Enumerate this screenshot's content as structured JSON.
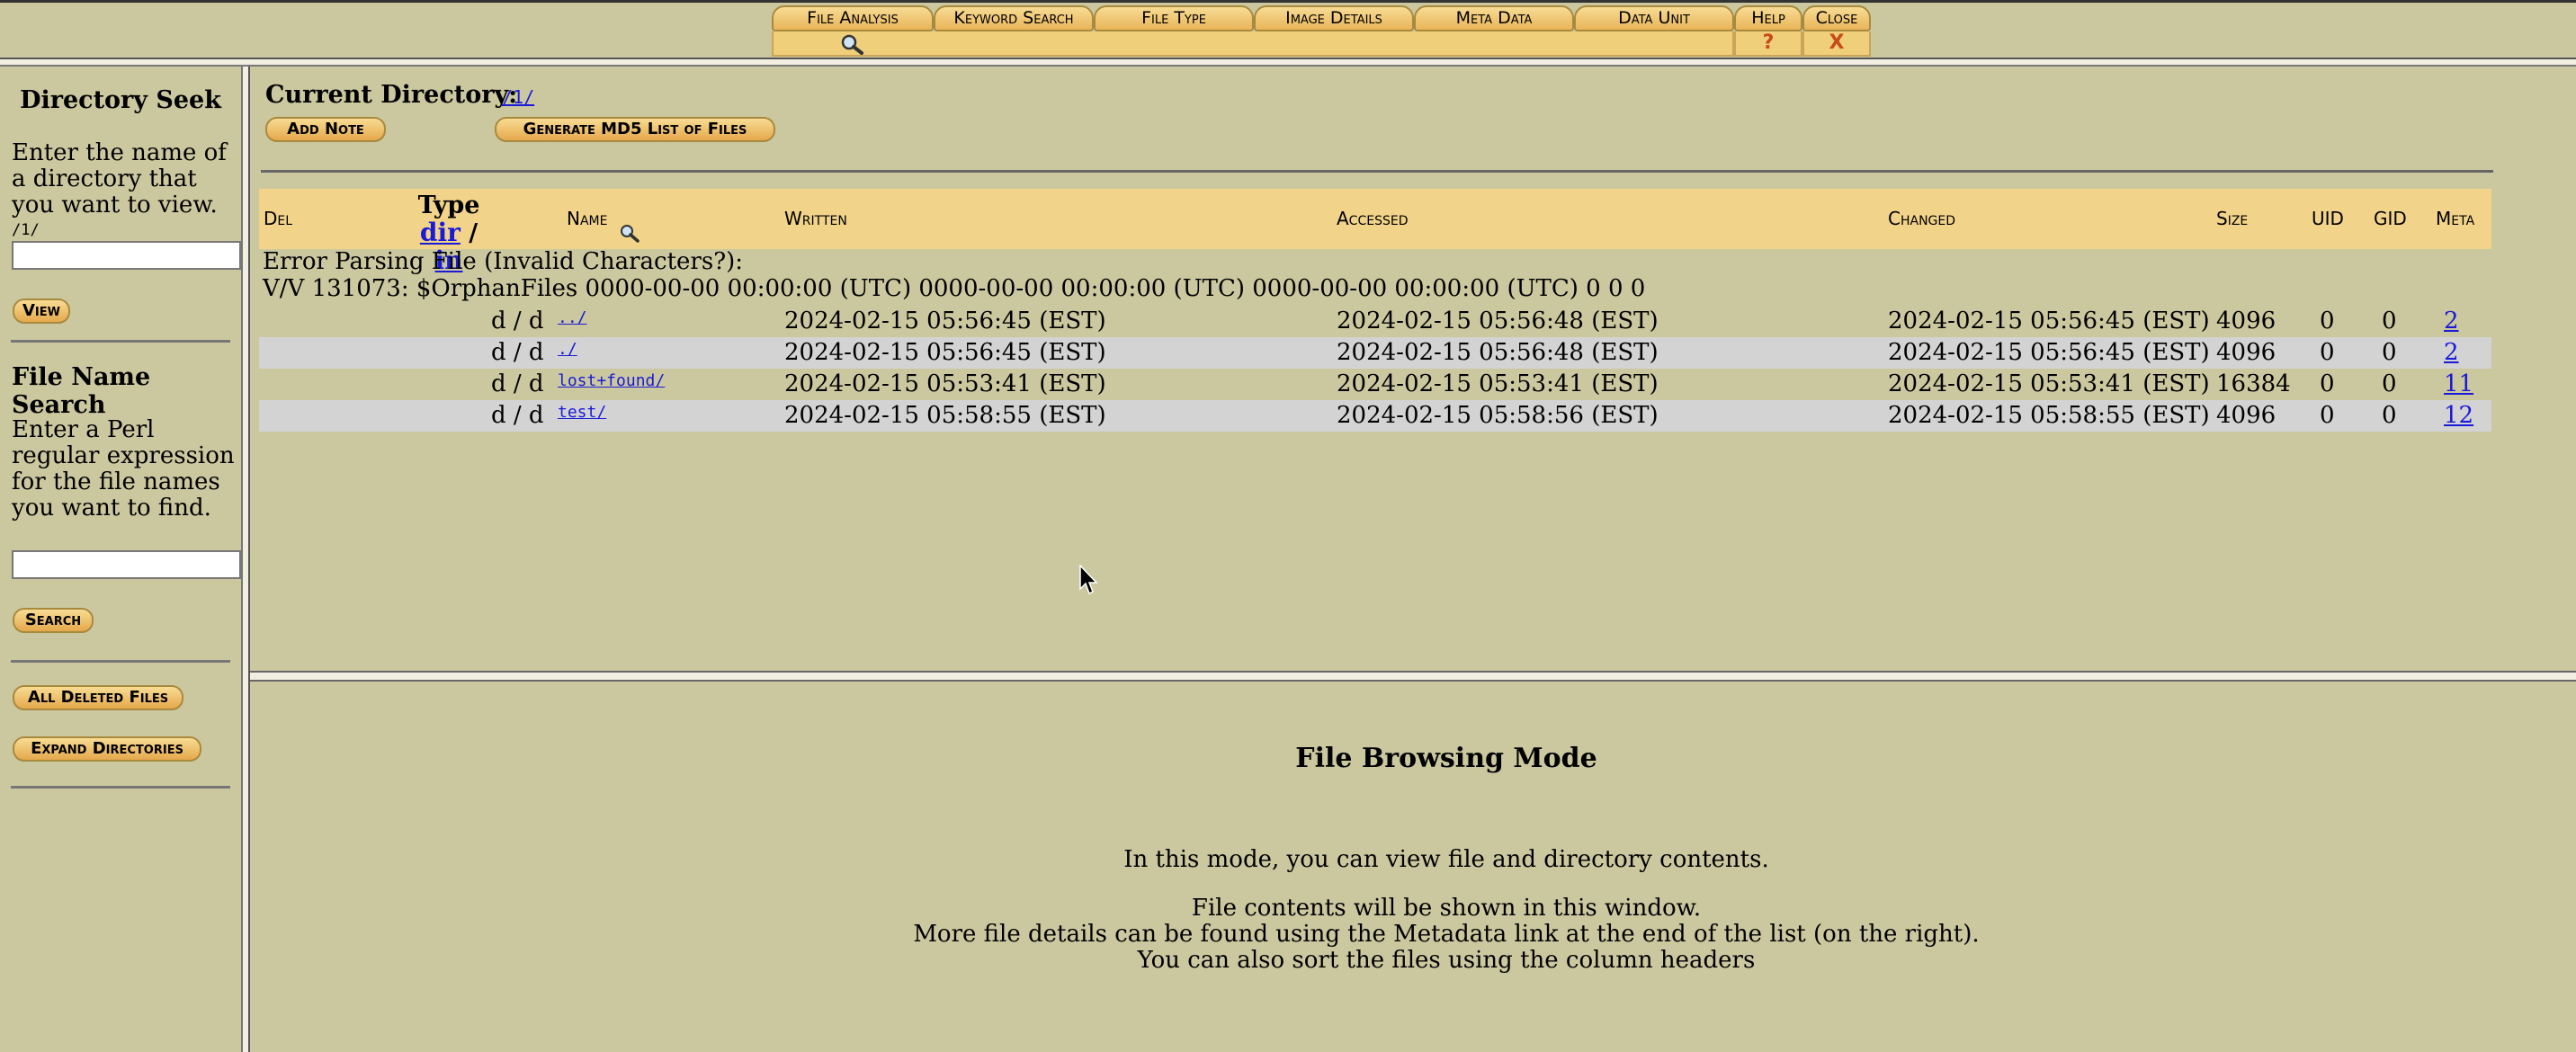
{
  "toolbar": {
    "tabs": [
      "File Analysis",
      "Keyword Search",
      "File Type",
      "Image Details",
      "Meta Data",
      "Data Unit",
      "Help",
      "Close"
    ],
    "help_glyph": "?",
    "close_glyph": "X"
  },
  "left": {
    "dir_seek_title": "Directory Seek",
    "dir_seek_text": "Enter the name of a directory that you want to view.",
    "dir_seek_value": "/1/",
    "view_button": "View",
    "file_search_title": "File Name Search",
    "file_search_text": "Enter a Perl regular expression for the file names you want to find.",
    "search_button": "Search",
    "all_deleted_button": "All Deleted Files",
    "expand_dirs_button": "Expand Directories"
  },
  "main": {
    "current_dir_label": "Current Directory:",
    "current_dir_link": "/1/",
    "add_note_button": "Add Note",
    "md5_button": "Generate MD5 List of Files",
    "columns": {
      "del": "Del",
      "type": "Type",
      "type_dir": "dir",
      "type_sep": "/",
      "type_in": "in",
      "name": "Name",
      "written": "Written",
      "accessed": "Accessed",
      "changed": "Changed",
      "size": "Size",
      "uid": "UID",
      "gid": "GID",
      "meta": "Meta"
    },
    "error_line1": "Error Parsing File (Invalid Characters?):",
    "error_line2": "V/V 131073: $OrphanFiles 0000-00-00 00:00:00 (UTC) 0000-00-00 00:00:00 (UTC) 0000-00-00 00:00:00 (UTC) 0 0 0",
    "rows": [
      {
        "type": "d / d",
        "name": "../",
        "written": "2024-02-15 05:56:45 (EST)",
        "accessed": "2024-02-15 05:56:48 (EST)",
        "changed": "2024-02-15 05:56:45 (EST)",
        "size": "4096",
        "uid": "0",
        "gid": "0",
        "meta": "2"
      },
      {
        "type": "d / d",
        "name": "./",
        "written": "2024-02-15 05:56:45 (EST)",
        "accessed": "2024-02-15 05:56:48 (EST)",
        "changed": "2024-02-15 05:56:45 (EST)",
        "size": "4096",
        "uid": "0",
        "gid": "0",
        "meta": "2"
      },
      {
        "type": "d / d",
        "name": "lost+found/",
        "written": "2024-02-15 05:53:41 (EST)",
        "accessed": "2024-02-15 05:53:41 (EST)",
        "changed": "2024-02-15 05:53:41 (EST)",
        "size": "16384",
        "uid": "0",
        "gid": "0",
        "meta": "11"
      },
      {
        "type": "d / d",
        "name": "test/",
        "written": "2024-02-15 05:58:55 (EST)",
        "accessed": "2024-02-15 05:58:56 (EST)",
        "changed": "2024-02-15 05:58:55 (EST)",
        "size": "4096",
        "uid": "0",
        "gid": "0",
        "meta": "12"
      }
    ]
  },
  "lower": {
    "title": "File Browsing Mode",
    "line1": "In this mode, you can view file and directory contents.",
    "line2": "File contents will be shown in this window.",
    "line3": "More file details can be found using the Metadata link at the end of the list (on the right).",
    "line4": "You can also sort the files using the column headers"
  }
}
